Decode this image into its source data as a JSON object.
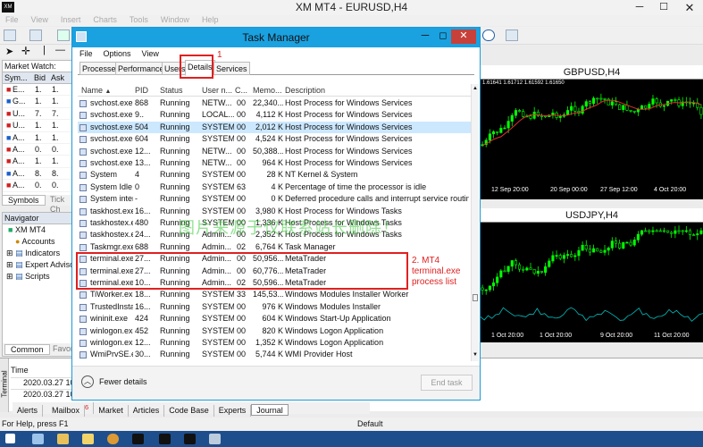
{
  "app": {
    "title": "XM MT4 - EURUSD,H4",
    "logo": "XM"
  },
  "menu": [
    "File",
    "View",
    "Insert",
    "Charts",
    "Tools",
    "Window",
    "Help"
  ],
  "market_watch": {
    "title": "Market Watch: 16:2",
    "columns": [
      "Sym...",
      "Bid",
      "Ask"
    ],
    "rows": [
      {
        "sym": "E...",
        "bid": "1.",
        "ask": "1."
      },
      {
        "sym": "G...",
        "bid": "1.",
        "ask": "1."
      },
      {
        "sym": "U...",
        "bid": "7.",
        "ask": "7."
      },
      {
        "sym": "U...",
        "bid": "1.",
        "ask": "1."
      },
      {
        "sym": "A...",
        "bid": "1.",
        "ask": "1."
      },
      {
        "sym": "A...",
        "bid": "0.",
        "ask": "0."
      },
      {
        "sym": "A...",
        "bid": "1.",
        "ask": "1."
      },
      {
        "sym": "A...",
        "bid": "8.",
        "ask": "8."
      },
      {
        "sym": "A...",
        "bid": "0.",
        "ask": "0."
      }
    ],
    "tabs": [
      "Symbols",
      "Tick Ch"
    ]
  },
  "navigator": {
    "title": "Navigator",
    "items": [
      "XM MT4",
      "Accounts",
      "Indicators",
      "Expert Advisors",
      "Scripts"
    ],
    "tabs": [
      "Common",
      "Favor"
    ]
  },
  "charts": [
    {
      "title": "GBPUSD,H4",
      "info": "1.61641 1.61712 1.61592 1.61650",
      "dates": [
        "12 Sep 20:00",
        "20 Sep 00:00",
        "27 Sep 12:00",
        "4 Oct 20:00"
      ]
    },
    {
      "title": "USDJPY,H4",
      "info": "...",
      "dates": [
        "1 Oct 20:00",
        "1 Oct 20:00",
        "9 Oct 20:00",
        "11 Oct 20:00"
      ]
    }
  ],
  "terminal": {
    "side_label": "Terminal",
    "col_time": "Time",
    "rows": [
      "2020.03.27 10:...",
      "2020.03.27 10:..."
    ],
    "tabs": [
      "Alerts",
      "Mailbox",
      "Market",
      "Articles",
      "Code Base",
      "Experts",
      "Journal"
    ],
    "mailbox_badge": "6"
  },
  "status": {
    "left": "For Help, press F1",
    "right": "Default"
  },
  "task_manager": {
    "title": "Task Manager",
    "menu": [
      "File",
      "Options",
      "View"
    ],
    "tabs": [
      "Processes",
      "Performance",
      "Users",
      "Details",
      "Services"
    ],
    "active_tab": "Details",
    "columns": [
      "Name",
      "PID",
      "Status",
      "User n...",
      "C...",
      "Memo...",
      "Description"
    ],
    "rows": [
      [
        "svchost.exe",
        "868",
        "Running",
        "NETW...",
        "00",
        "22,340...",
        "Host Process for Windows Services"
      ],
      [
        "svchost.exe",
        "9..",
        "Running",
        "LOCAL...",
        "00",
        "4,112 K",
        "Host Process for Windows Services"
      ],
      [
        "svchost.exe",
        "504",
        "Running",
        "SYSTEM",
        "00",
        "2,012 K",
        "Host Process for Windows Services"
      ],
      [
        "svchost.exe",
        "604",
        "Running",
        "SYSTEM",
        "00",
        "4,524 K",
        "Host Process for Windows Services"
      ],
      [
        "svchost.exe",
        "12...",
        "Running",
        "NETW...",
        "00",
        "50,388...",
        "Host Process for Windows Services"
      ],
      [
        "svchost.exe",
        "13...",
        "Running",
        "NETW...",
        "00",
        "964 K",
        "Host Process for Windows Services"
      ],
      [
        "System",
        "4",
        "Running",
        "SYSTEM",
        "00",
        "28 K",
        "NT Kernel & System"
      ],
      [
        "System Idle ...",
        "0",
        "Running",
        "SYSTEM",
        "63",
        "4 K",
        "Percentage of time the processor is idle"
      ],
      [
        "System inter...",
        "-",
        "Running",
        "SYSTEM",
        "00",
        "0 K",
        "Deferred procedure calls and interrupt service routines"
      ],
      [
        "taskhost.exe",
        "16...",
        "Running",
        "SYSTEM",
        "00",
        "3,980 K",
        "Host Process for Windows Tasks"
      ],
      [
        "taskhostex.exe",
        "480",
        "Running",
        "SYSTEM",
        "00",
        "1,336 K",
        "Host Process for Windows Tasks"
      ],
      [
        "taskhostex.exe",
        "24...",
        "Running",
        "Admin...",
        "00",
        "2,352 K",
        "Host Process for Windows Tasks"
      ],
      [
        "Taskmgr.exe",
        "688",
        "Running",
        "Admin...",
        "02",
        "6,764 K",
        "Task Manager"
      ],
      [
        "terminal.exe",
        "27...",
        "Running",
        "Admin...",
        "00",
        "50,956...",
        "MetaTrader"
      ],
      [
        "terminal.exe",
        "27...",
        "Running",
        "Admin...",
        "00",
        "60,776...",
        "MetaTrader"
      ],
      [
        "terminal.exe",
        "10...",
        "Running",
        "Admin...",
        "02",
        "50,596...",
        "MetaTrader"
      ],
      [
        "TiWorker.exe",
        "18...",
        "Running",
        "SYSTEM",
        "33",
        "145,53...",
        "Windows Modules Installer Worker"
      ],
      [
        "TrustedInsta...",
        "16...",
        "Running",
        "SYSTEM",
        "00",
        "976 K",
        "Windows Modules Installer"
      ],
      [
        "wininit.exe",
        "424",
        "Running",
        "SYSTEM",
        "00",
        "604 K",
        "Windows Start-Up Application"
      ],
      [
        "winlogon.exe",
        "452",
        "Running",
        "SYSTEM",
        "00",
        "820 K",
        "Windows Logon Application"
      ],
      [
        "winlogon.exe",
        "12...",
        "Running",
        "SYSTEM",
        "00",
        "1,352 K",
        "Windows Logon Application"
      ],
      [
        "WmiPrvSE.exe",
        "30...",
        "Running",
        "SYSTEM",
        "00",
        "5,744 K",
        "WMI Provider Host"
      ]
    ],
    "fewer_details": "Fewer details",
    "end_task": "End task"
  },
  "annotations": {
    "label1": "1",
    "label2": "2. MT4 terminal.exe process list",
    "watermark": "图片来源于仅联系站长删除！"
  },
  "colors": {
    "accent": "#1aa1e0",
    "annotation": "#e02020",
    "chart_bg": "#000000",
    "bull": "#00ff00",
    "ma": "#e03030"
  }
}
